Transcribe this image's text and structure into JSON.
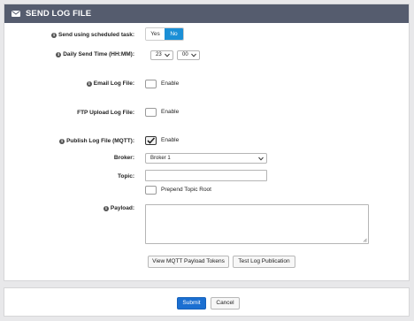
{
  "header": {
    "title": "SEND LOG FILE",
    "icon": "envelope-icon"
  },
  "schedule": {
    "label": "Send using scheduled task:",
    "options": [
      "Yes",
      "No"
    ],
    "selected": "No"
  },
  "daily_time": {
    "label": "Daily Send Time (HH:MM):",
    "hour": "23",
    "minute": "00"
  },
  "email": {
    "label": "Email Log File:",
    "checkbox_label": "Enable",
    "checked": false
  },
  "ftp": {
    "label": "FTP Upload Log File:",
    "checkbox_label": "Enable",
    "checked": false
  },
  "mqtt": {
    "label": "Publish Log File (MQTT):",
    "checkbox_label": "Enable",
    "checked": true,
    "broker_label": "Broker:",
    "broker_value": "Broker 1",
    "topic_label": "Topic:",
    "topic_value": "",
    "prepend_label": "Prepend Topic Root",
    "prepend_checked": false,
    "payload_label": "Payload:",
    "payload_value": "",
    "view_tokens_button": "View MQTT Payload Tokens",
    "test_button": "Test Log Publication"
  },
  "footer": {
    "submit": "Submit",
    "cancel": "Cancel"
  },
  "colors": {
    "header_bg": "#555c6e",
    "accent": "#1b8fd6",
    "primary": "#1b6fd1"
  }
}
